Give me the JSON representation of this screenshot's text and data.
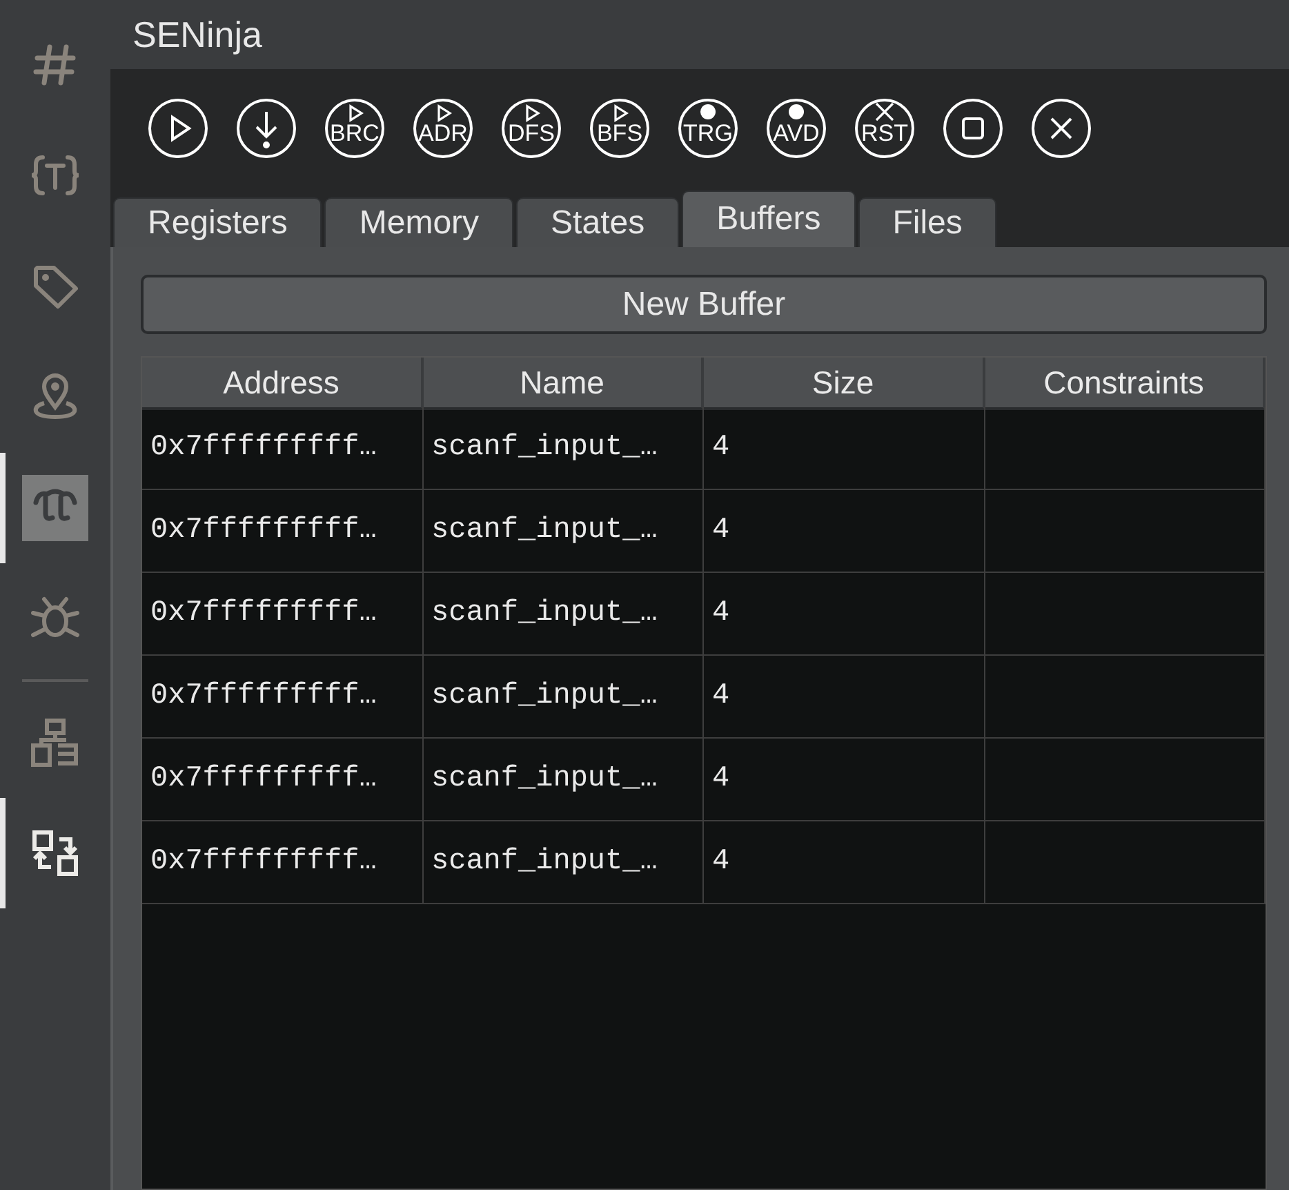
{
  "sidebar": {
    "items": [
      {
        "selected": false
      },
      {
        "selected": false
      },
      {
        "selected": false
      },
      {
        "selected": false
      },
      {
        "selected": true
      },
      {
        "selected": false
      }
    ],
    "bottom_items": [
      {
        "selected": false
      },
      {
        "selected": true
      }
    ]
  },
  "window": {
    "title": "SENinja"
  },
  "toolbar": [
    {
      "kind": "play"
    },
    {
      "kind": "step"
    },
    {
      "kind": "labeled_play",
      "label": "BRC"
    },
    {
      "kind": "labeled_play",
      "label": "ADR"
    },
    {
      "kind": "labeled_play",
      "label": "DFS"
    },
    {
      "kind": "labeled_play",
      "label": "BFS"
    },
    {
      "kind": "labeled_dot",
      "label": "TRG"
    },
    {
      "kind": "labeled_dot",
      "label": "AVD"
    },
    {
      "kind": "labeled_cross",
      "label": "RST"
    },
    {
      "kind": "stop"
    },
    {
      "kind": "close"
    }
  ],
  "tabs": [
    {
      "label": "Registers",
      "selected": false
    },
    {
      "label": "Memory",
      "selected": false
    },
    {
      "label": "States",
      "selected": false
    },
    {
      "label": "Buffers",
      "selected": true
    },
    {
      "label": "Files",
      "selected": false
    }
  ],
  "new_buffer_button": "New Buffer",
  "table": {
    "columns": [
      "Address",
      "Name",
      "Size",
      "Constraints"
    ],
    "rows": [
      [
        "0x7fffffffff…",
        "scanf_input_…",
        "4",
        ""
      ],
      [
        "0x7fffffffff…",
        "scanf_input_…",
        "4",
        ""
      ],
      [
        "0x7fffffffff…",
        "scanf_input_…",
        "4",
        ""
      ],
      [
        "0x7fffffffff…",
        "scanf_input_…",
        "4",
        ""
      ],
      [
        "0x7fffffffff…",
        "scanf_input_…",
        "4",
        ""
      ],
      [
        "0x7fffffffff…",
        "scanf_input_…",
        "4",
        ""
      ]
    ]
  }
}
